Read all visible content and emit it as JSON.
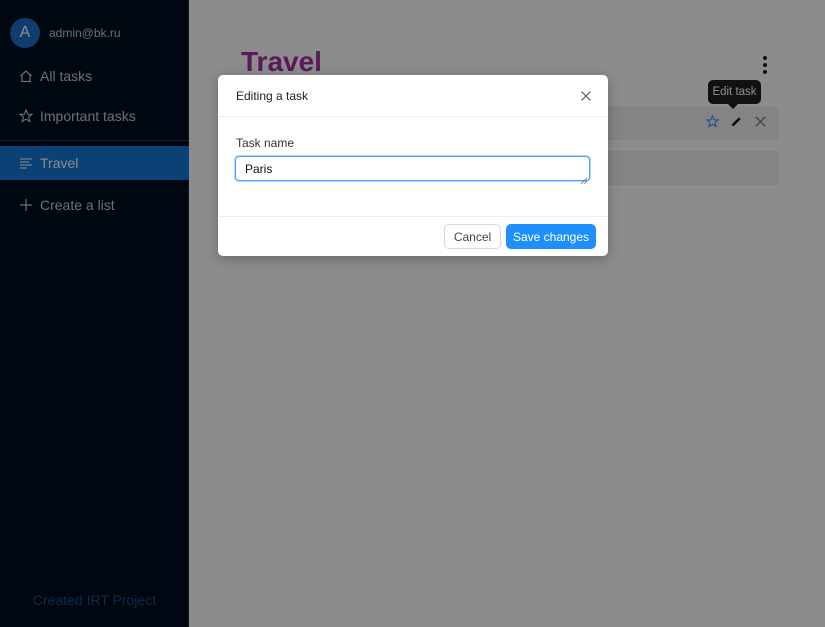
{
  "sidebar": {
    "user": {
      "avatar_letter": "A",
      "email": "admin@bk.ru"
    },
    "items": [
      {
        "label": "All tasks",
        "icon": "home-icon"
      },
      {
        "label": "Important tasks",
        "icon": "star-icon"
      },
      {
        "label": "Travel",
        "icon": "list-lines-icon",
        "active": true
      },
      {
        "label": "Create a list",
        "icon": "plus-icon"
      }
    ],
    "footer": "Created IRT Project"
  },
  "main": {
    "list_title": "Travel",
    "tooltip": "Edit task"
  },
  "modal": {
    "title": "Editing a task",
    "field_label": "Task name",
    "field_value": "Paris",
    "cancel_label": "Cancel",
    "save_label": "Save changes"
  },
  "colors": {
    "sidebar_bg": "#000d1e",
    "accent": "#1777d6",
    "title": "#a72fa3",
    "primary_button": "#1f8ffb"
  }
}
